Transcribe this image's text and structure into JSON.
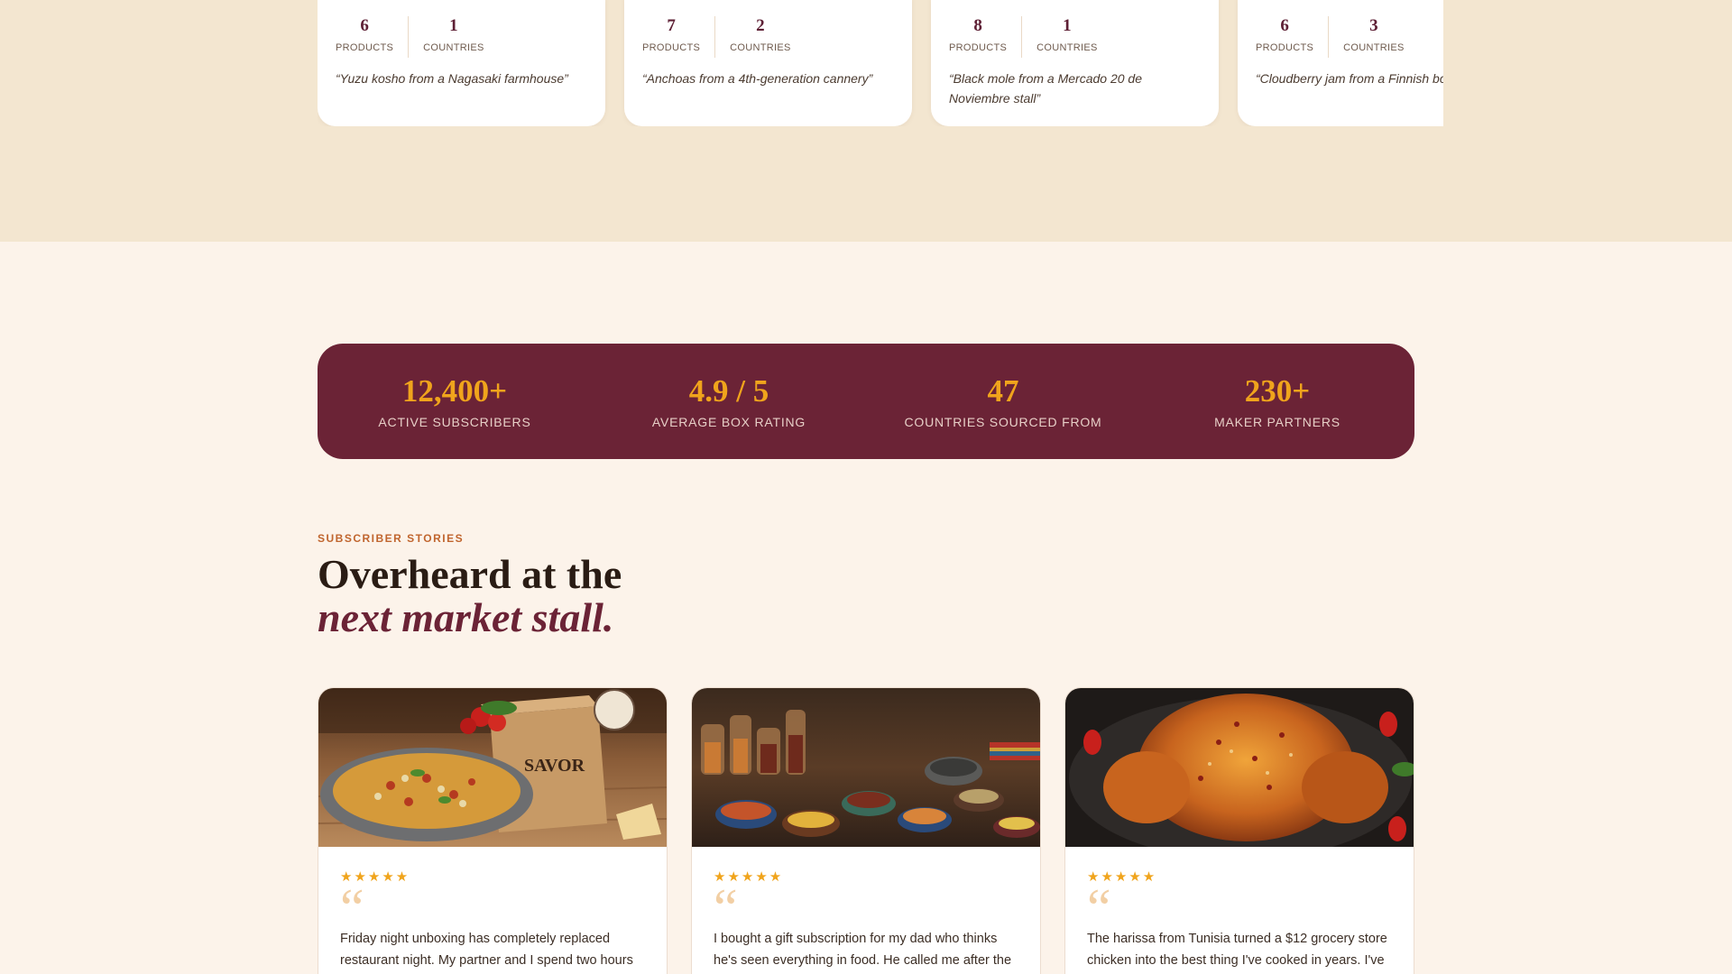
{
  "regions": [
    {
      "products": "6",
      "products_label": "PRODUCTS",
      "countries": "1",
      "countries_label": "COUNTRIES",
      "quote": "“Yuzu kosho from a Nagasaki farmhouse”"
    },
    {
      "products": "7",
      "products_label": "PRODUCTS",
      "countries": "2",
      "countries_label": "COUNTRIES",
      "quote": "“Anchoas from a 4th-generation cannery”"
    },
    {
      "products": "8",
      "products_label": "PRODUCTS",
      "countries": "1",
      "countries_label": "COUNTRIES",
      "quote": "“Black mole from a Mercado 20 de Noviembre stall”"
    },
    {
      "products": "6",
      "products_label": "PRODUCTS",
      "countries": "3",
      "countries_label": "COUNTRIES",
      "quote": "“Cloudberry jam from a Finnish bo"
    }
  ],
  "stats": [
    {
      "value": "12,400+",
      "label": "ACTIVE SUBSCRIBERS"
    },
    {
      "value": "4.9 / 5",
      "label": "AVERAGE BOX RATING"
    },
    {
      "value": "47",
      "label": "COUNTRIES SOURCED FROM"
    },
    {
      "value": "230+",
      "label": "MAKER PARTNERS"
    }
  ],
  "stories": {
    "eyebrow": "SUBSCRIBER STORIES",
    "title_line1": "Overheard at the",
    "title_line2": "next market stall.",
    "cards": [
      {
        "stars": "★★★★★",
        "quote_mark": "“",
        "text": "Friday night unboxing has completely replaced restaurant night. My partner and I spend two hours in",
        "box_label": "SAVOR"
      },
      {
        "stars": "★★★★★",
        "quote_mark": "“",
        "text": "I bought a gift subscription for my dad who thinks he's seen everything in food. He called me after the"
      },
      {
        "stars": "★★★★★",
        "quote_mark": "“",
        "text": "The harissa from Tunisia turned a $12 grocery store chicken into the best thing I've cooked in years. I've"
      }
    ]
  },
  "colors": {
    "burgundy": "#6b2336",
    "gold": "#f0a41c",
    "cream": "#fcf3ea",
    "band": "#f3e6d0",
    "eyebrow": "#c0652e"
  }
}
